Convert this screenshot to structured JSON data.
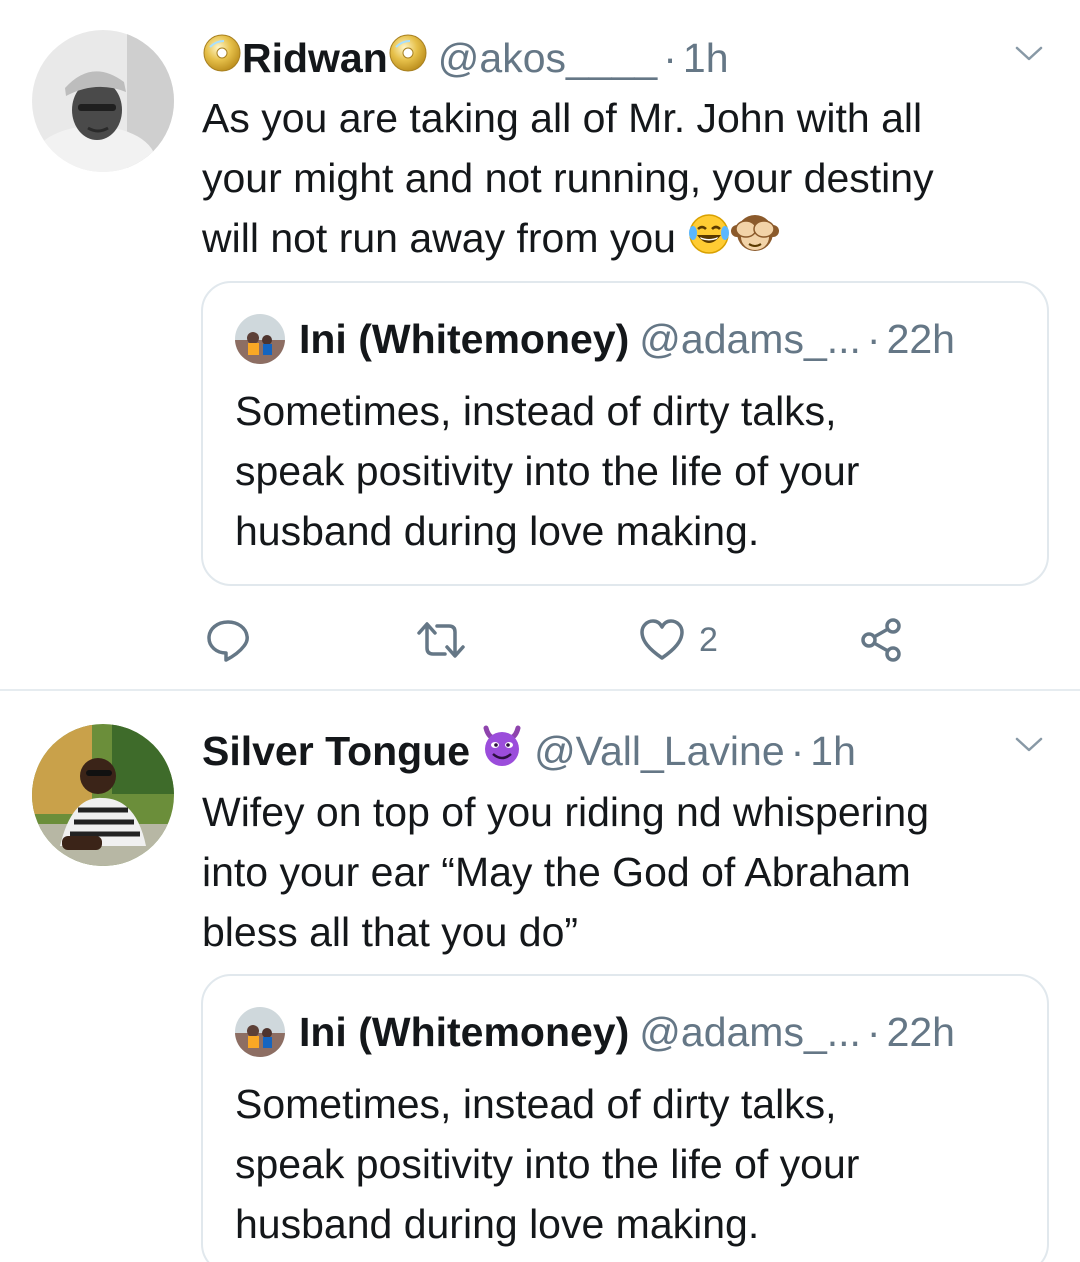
{
  "tweets": [
    {
      "author": {
        "name": "Ridwan",
        "handle": "@akos____",
        "time": "1h",
        "avatar": "avatar-man-cap-icon",
        "name_emoji": "cd-icon"
      },
      "text_lines": [
        "As you are taking all of Mr. John with all",
        "your might and not running, your destiny",
        "will not run away from you"
      ],
      "text_emojis": [
        "tears-of-joy-emoji",
        "see-no-evil-monkey-emoji"
      ],
      "quoted": {
        "name": "Ini (Whitemoney)",
        "handle": "@adams_...",
        "time": "22h",
        "text_lines": [
          "Sometimes, instead of dirty talks,",
          "speak positivity into the life of your",
          "husband during love making."
        ]
      },
      "actions": {
        "reply_icon": "reply-icon",
        "retweet_icon": "retweet-icon",
        "like_icon": "heart-icon",
        "like_count": "2",
        "share_icon": "share-icon"
      }
    },
    {
      "author": {
        "name": "Silver Tongue",
        "handle": "@Vall_Lavine",
        "time": "1h",
        "avatar": "avatar-man-sunglasses-icon",
        "name_emoji": "smiling-devil-emoji"
      },
      "text_lines": [
        "Wifey on top of you riding nd whispering",
        "into your ear “May the God of Abraham",
        "bless all that you do”"
      ],
      "quoted": {
        "name": "Ini (Whitemoney)",
        "handle": "@adams_...",
        "time": "22h",
        "text_lines": [
          "Sometimes, instead of dirty talks,",
          "speak positivity into the life of your",
          "husband during love making."
        ]
      }
    }
  ],
  "colors": {
    "text_primary": "#14171a",
    "text_secondary": "#657786",
    "border": "#e1e8ed",
    "devil_purple": "#9b4ddb"
  }
}
